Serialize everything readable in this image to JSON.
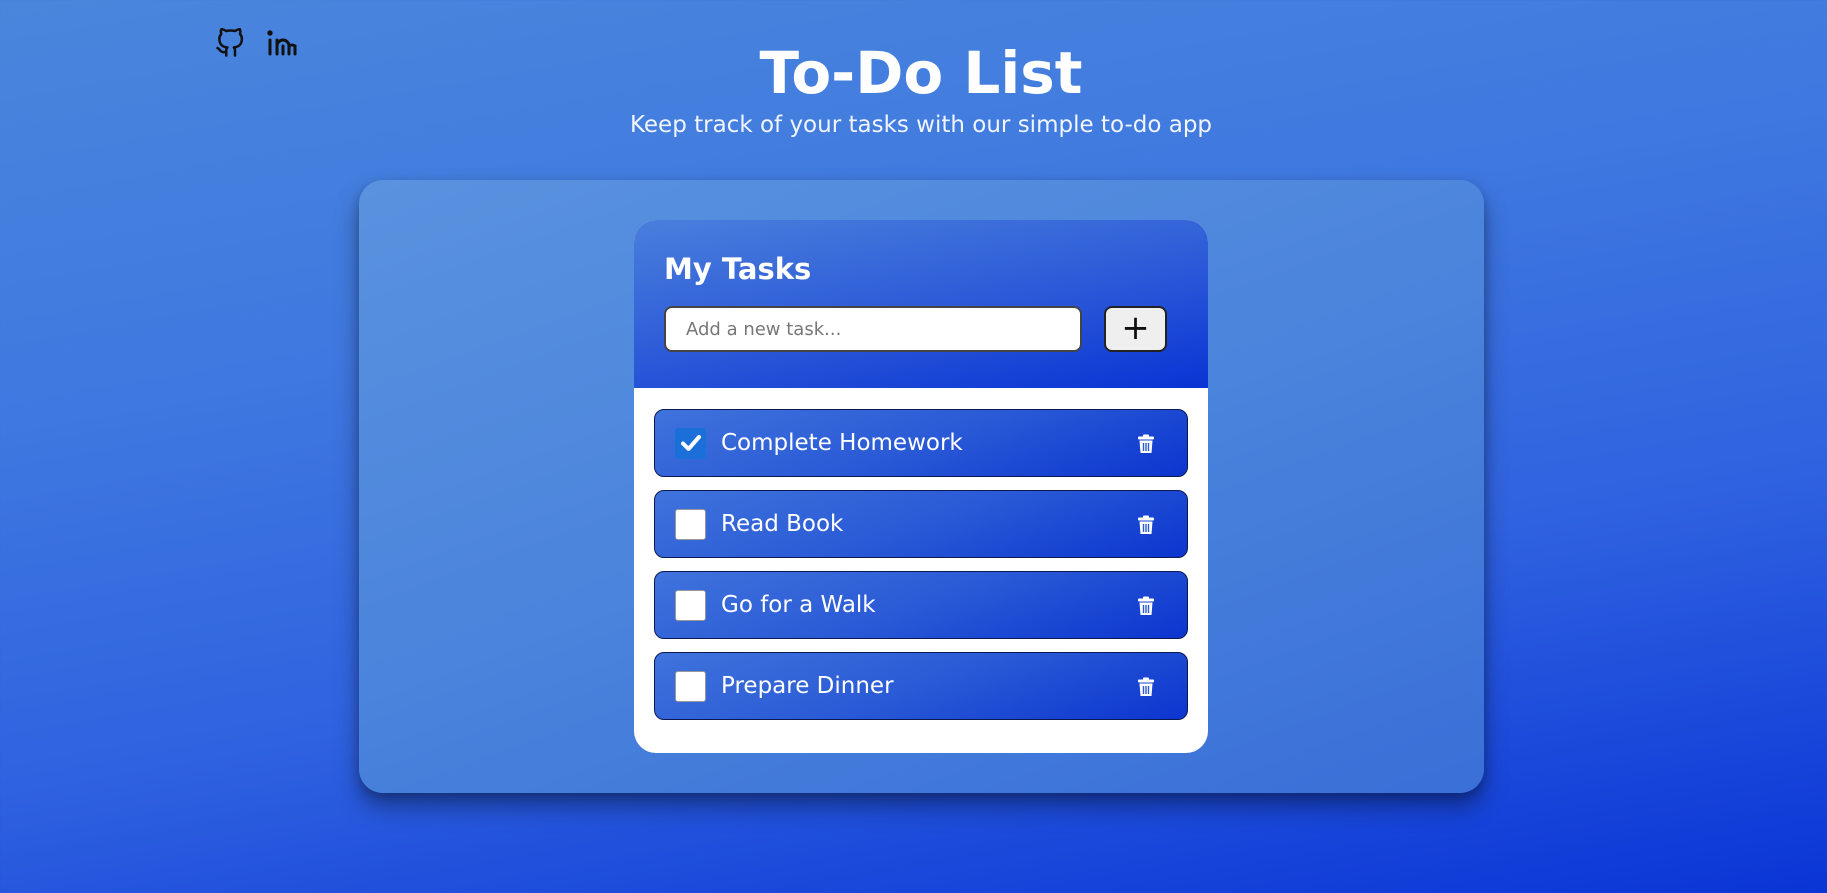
{
  "social": {
    "github_icon": "github-icon",
    "linkedin_icon": "linkedin-icon"
  },
  "header": {
    "title": "To-Do List",
    "subtitle": "Keep track of your tasks with our simple to-do app"
  },
  "card": {
    "title": "My Tasks",
    "input_placeholder": "Add a new task...",
    "add_button_label": "+"
  },
  "tasks": [
    {
      "label": "Complete Homework",
      "checked": true
    },
    {
      "label": "Read Book",
      "checked": false
    },
    {
      "label": "Go for a Walk",
      "checked": false
    },
    {
      "label": "Prepare Dinner",
      "checked": false
    }
  ],
  "colors": {
    "accent": "#0a34d4",
    "checkbox_checked": "#1a6fd9"
  }
}
